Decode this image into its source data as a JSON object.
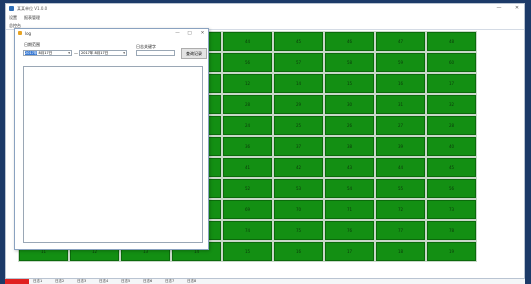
{
  "main_window": {
    "title": "某某单位 V1.0.0",
    "minimize": "—",
    "close": "✕",
    "menu": [
      "设置",
      "报表管理"
    ],
    "tab": "总控台"
  },
  "grid": {
    "rows": [
      [
        "",
        "",
        "",
        "",
        "44",
        "45",
        "46",
        "47",
        "48"
      ],
      [
        "",
        "",
        "",
        "",
        "56",
        "57",
        "58",
        "59",
        "60"
      ],
      [
        "",
        "",
        "",
        "",
        "12",
        "14",
        "15",
        "16",
        "17"
      ],
      [
        "",
        "",
        "",
        "",
        "28",
        "29",
        "30",
        "31",
        "32"
      ],
      [
        "",
        "",
        "",
        "",
        "24",
        "25",
        "26",
        "27",
        "28"
      ],
      [
        "",
        "",
        "",
        "",
        "36",
        "37",
        "38",
        "39",
        "40"
      ],
      [
        "",
        "",
        "",
        "",
        "41",
        "42",
        "43",
        "44",
        "45"
      ],
      [
        "",
        "",
        "",
        "",
        "52",
        "53",
        "54",
        "55",
        "56"
      ],
      [
        "",
        "",
        "",
        "",
        "69",
        "70",
        "71",
        "72",
        "73"
      ],
      [
        "",
        "",
        "",
        "",
        "74",
        "75",
        "76",
        "77",
        "78"
      ],
      [
        "11",
        "12",
        "13",
        "14",
        "15",
        "16",
        "17",
        "18",
        "19"
      ]
    ]
  },
  "dialog": {
    "title": "log",
    "minimize": "—",
    "maximize": "□",
    "close": "✕",
    "date_range_label": "日期范围",
    "start_date_selected": "2017年",
    "start_date_rest": " 8月17日",
    "separator": "—",
    "end_date": "2017年 8月17日",
    "keyword_label": "日志关键字",
    "keyword_value": "",
    "query_button": "查询记录"
  },
  "statusbar": {
    "tabs": [
      "日志1",
      "日志2",
      "日志3",
      "日志4",
      "日志5",
      "日志6",
      "日志7",
      "日志8"
    ]
  },
  "colors": {
    "cell_green": "#138f13",
    "desktop": "#1c3a68",
    "status_active": "#e02020"
  }
}
